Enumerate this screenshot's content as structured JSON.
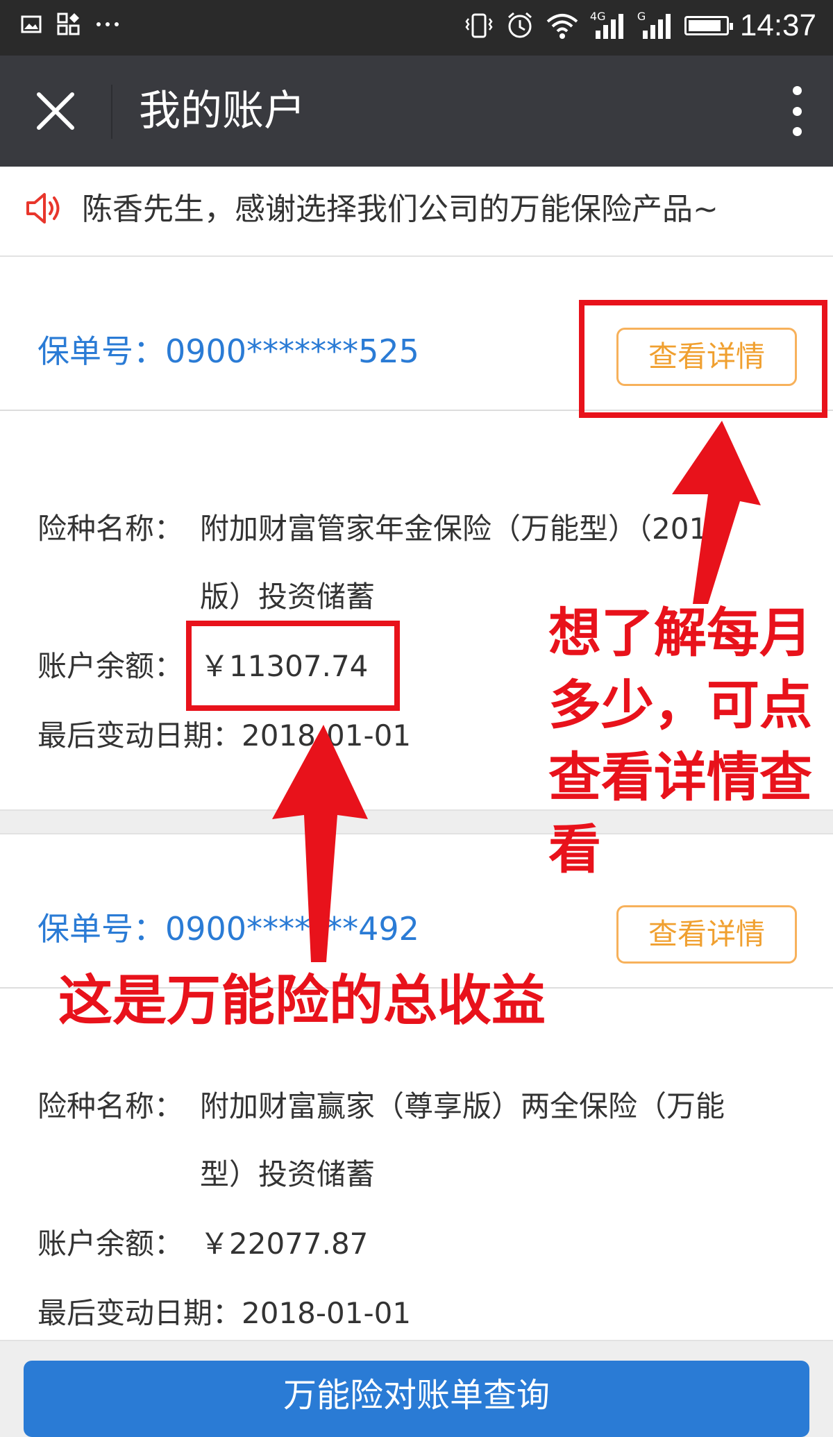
{
  "status_bar": {
    "left_icons": [
      "image-icon",
      "app-grid-icon",
      "more-dots-icon"
    ],
    "right_icons": [
      "vibrate-icon",
      "alarm-icon",
      "wifi-icon",
      "signal-4g-icon",
      "signal-g-icon",
      "battery-icon"
    ],
    "signal_1_label": "4G",
    "signal_2_label": "G",
    "time": "14:37"
  },
  "header": {
    "title": "我的账户",
    "close_icon": "close-icon",
    "more_icon": "vertical-dots-icon"
  },
  "notice": {
    "icon": "speaker-icon",
    "text": "陈香先生，感谢选择我们公司的万能保险产品~"
  },
  "policies": [
    {
      "policy_label": "保单号：",
      "policy_no": "0900*******525",
      "detail_button": "查看详情",
      "product_key": "险种名称：",
      "product_line1": "附加财富管家年金保险（万能型）（2013",
      "product_line2": "版）投资储蓄",
      "balance_key": "账户余额：",
      "balance": "￥11307.74",
      "date_key": "最后变动日期：",
      "date": "2018-01-01"
    },
    {
      "policy_label": "保单号：",
      "policy_no": "0900*******492",
      "detail_button": "查看详情",
      "product_key": "险种名称：",
      "product_line1": "附加财富赢家（尊享版）两全保险（万能",
      "product_line2": "型）投资储蓄",
      "balance_key": "账户余额：",
      "balance": "￥22077.87",
      "date_key": "最后变动日期：",
      "date": "2018-01-01"
    }
  ],
  "bottom_button": "万能险对账单查询",
  "annotations": {
    "note_right_lines": [
      "想了解每月",
      "多少，可点",
      "查看详情查",
      "看"
    ],
    "note_bottom": "这是万能险的总收益",
    "color": "#e8121b"
  },
  "colors": {
    "header_bg": "#393a3f",
    "status_bg": "#2a2a2a",
    "policy_blue": "#2a7bd5",
    "button_orange": "#f0a030",
    "speaker_red": "#e8362c"
  }
}
